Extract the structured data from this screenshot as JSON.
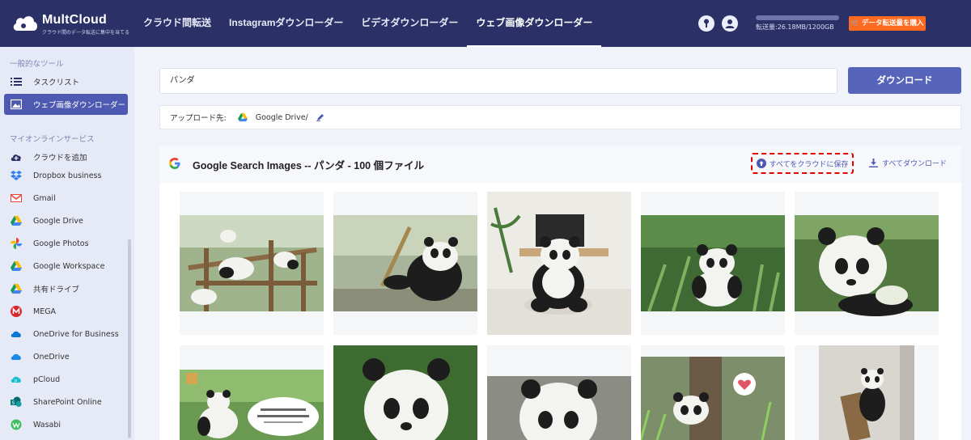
{
  "header": {
    "logo_name": "MultCloud",
    "logo_tagline": "クラウド間のデータ転送に集中を当てる",
    "nav": [
      {
        "label": "クラウド間転送",
        "active": false
      },
      {
        "label": "Instagramダウンローダー",
        "active": false
      },
      {
        "label": "ビデオダウンローダー",
        "active": false
      },
      {
        "label": "ウェブ画像ダウンローダー",
        "active": true
      }
    ],
    "usage_text": "転送量:26.18MB/1200GB",
    "usage_fraction": 0.0,
    "buy_label": "データ転送量を購入"
  },
  "sidebar": {
    "section_tools": "一般的なツール",
    "tools": [
      {
        "label": "タスクリスト",
        "icon": "list-icon",
        "active": false
      },
      {
        "label": "ウェブ画像ダウンローダー",
        "icon": "image-icon",
        "active": true
      }
    ],
    "section_services": "マイオンラインサービス",
    "add_cloud": "クラウドを追加",
    "services": [
      {
        "label": "Dropbox business",
        "icon": "dropbox-icon"
      },
      {
        "label": "Gmail",
        "icon": "gmail-icon"
      },
      {
        "label": "Google Drive",
        "icon": "google-drive-icon"
      },
      {
        "label": "Google Photos",
        "icon": "google-photos-icon"
      },
      {
        "label": "Google Workspace",
        "icon": "google-workspace-icon"
      },
      {
        "label": "共有ドライブ",
        "icon": "shared-drive-icon"
      },
      {
        "label": "MEGA",
        "icon": "mega-icon"
      },
      {
        "label": "OneDrive for Business",
        "icon": "onedrive-business-icon"
      },
      {
        "label": "OneDrive",
        "icon": "onedrive-icon"
      },
      {
        "label": "pCloud",
        "icon": "pcloud-icon"
      },
      {
        "label": "SharePoint Online",
        "icon": "sharepoint-icon"
      },
      {
        "label": "Wasabi",
        "icon": "wasabi-icon"
      }
    ]
  },
  "main": {
    "search_value": "パンダ",
    "download_button": "ダウンロード",
    "upload_label": "アップロード先:",
    "upload_target": "Google Drive/",
    "result_title": "Google Search Images -- パンダ - 100 個ファイル",
    "save_all_label": "すべてをクラウドに保存",
    "download_all_label": "すべてダウンロード"
  },
  "colors": {
    "header_bg": "#2b3166",
    "accent": "#5664b9",
    "buy_button": "#ff6a1f",
    "highlight_border": "#e00000"
  }
}
